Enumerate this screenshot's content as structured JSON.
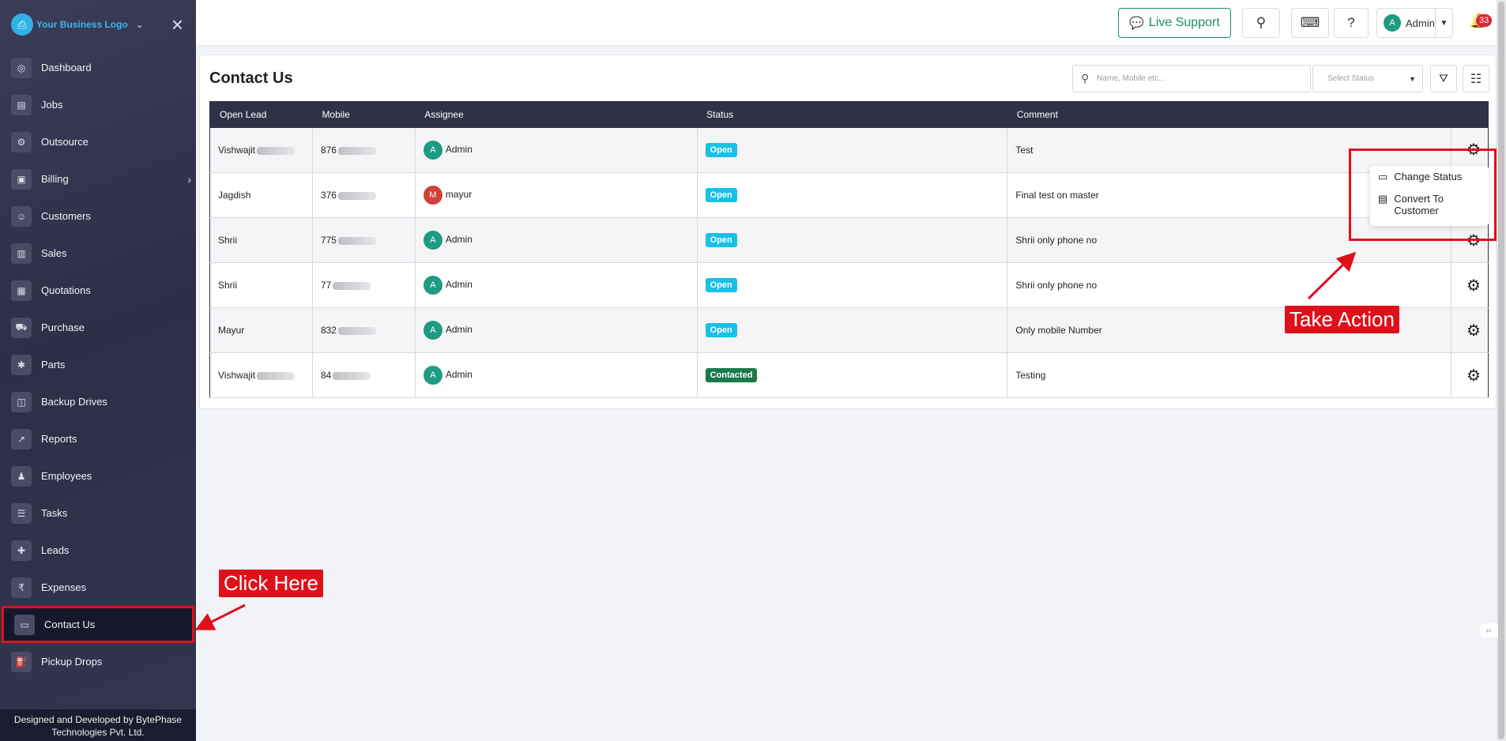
{
  "sidebar": {
    "logo_text": "Your Business Logo",
    "items": [
      {
        "label": "Dashboard",
        "icon": "◎"
      },
      {
        "label": "Jobs",
        "icon": "▤"
      },
      {
        "label": "Outsource",
        "icon": "⚙"
      },
      {
        "label": "Billing",
        "icon": "▣"
      },
      {
        "label": "Customers",
        "icon": "☺"
      },
      {
        "label": "Sales",
        "icon": "▥"
      },
      {
        "label": "Quotations",
        "icon": "▦"
      },
      {
        "label": "Purchase",
        "icon": "⛟"
      },
      {
        "label": "Parts",
        "icon": "✱"
      },
      {
        "label": "Backup Drives",
        "icon": "◫"
      },
      {
        "label": "Reports",
        "icon": "↗"
      },
      {
        "label": "Employees",
        "icon": "♟"
      },
      {
        "label": "Tasks",
        "icon": "☰"
      },
      {
        "label": "Leads",
        "icon": "✚"
      },
      {
        "label": "Expenses",
        "icon": "₹"
      },
      {
        "label": "Contact Us",
        "icon": "▭"
      },
      {
        "label": "Pickup Drops",
        "icon": "⛽"
      }
    ],
    "footer": "Designed and Developed by BytePhase Technologies Pvt. Ltd."
  },
  "topbar": {
    "live_support": "Live Support",
    "user": "Admin",
    "user_initial": "A",
    "notifications": "33"
  },
  "page": {
    "title": "Contact Us",
    "search_placeholder": "Name, Mobile etc...",
    "status_placeholder": "Select Status"
  },
  "table": {
    "headers": [
      "Open Lead",
      "Mobile",
      "Assignee",
      "Status",
      "Comment"
    ],
    "rows": [
      {
        "name": "Vishwajit",
        "mobile": "876",
        "assignee": "Admin",
        "initial": "A",
        "status": "Open",
        "comment": "Test"
      },
      {
        "name": "Jagdish",
        "mobile": "376",
        "assignee": "mayur",
        "initial": "M",
        "status": "Open",
        "comment": "Final test on master"
      },
      {
        "name": "Shrii",
        "mobile": "775",
        "assignee": "Admin",
        "initial": "A",
        "status": "Open",
        "comment": "Shrii only phone no"
      },
      {
        "name": "Shrii",
        "mobile": "77",
        "assignee": "Admin",
        "initial": "A",
        "status": "Open",
        "comment": "Shrii only phone no"
      },
      {
        "name": "Mayur",
        "mobile": "832",
        "assignee": "Admin",
        "initial": "A",
        "status": "Open",
        "comment": "Only mobile Number"
      },
      {
        "name": "Vishwajit",
        "mobile": "84",
        "assignee": "Admin",
        "initial": "A",
        "status": "Contacted",
        "comment": "Testing"
      }
    ]
  },
  "dropdown": {
    "change_status": "Change Status",
    "convert": "Convert To Customer"
  },
  "annotations": {
    "click_here": "Click Here",
    "take_action": "Take Action"
  }
}
